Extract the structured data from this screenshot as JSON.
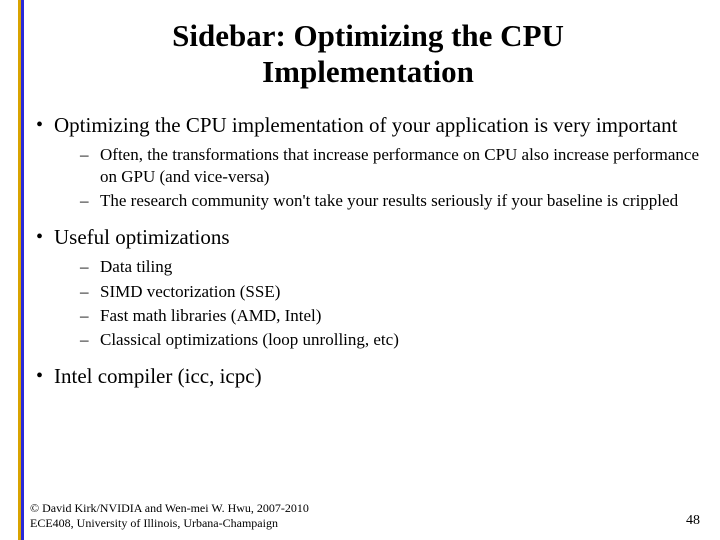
{
  "title_line1": "Sidebar: Optimizing the CPU",
  "title_line2": "Implementation",
  "bullets": {
    "b1": "Optimizing the CPU implementation of your application is very important",
    "b1_sub": {
      "s1": "Often, the transformations that increase performance on CPU also increase performance on GPU (and vice-versa)",
      "s2": "The research community won't take your results seriously if your baseline is crippled"
    },
    "b2": "Useful optimizations",
    "b2_sub": {
      "s1": "Data tiling",
      "s2": "SIMD vectorization (SSE)",
      "s3": "Fast math libraries (AMD, Intel)",
      "s4": "Classical optimizations (loop unrolling, etc)"
    },
    "b3": "Intel compiler (icc, icpc)"
  },
  "footer": {
    "copyright_line1": "© David Kirk/NVIDIA and Wen-mei W. Hwu, 2007-2010",
    "copyright_line2": "ECE408, University of Illinois, Urbana-Champaign",
    "page_number": "48"
  }
}
